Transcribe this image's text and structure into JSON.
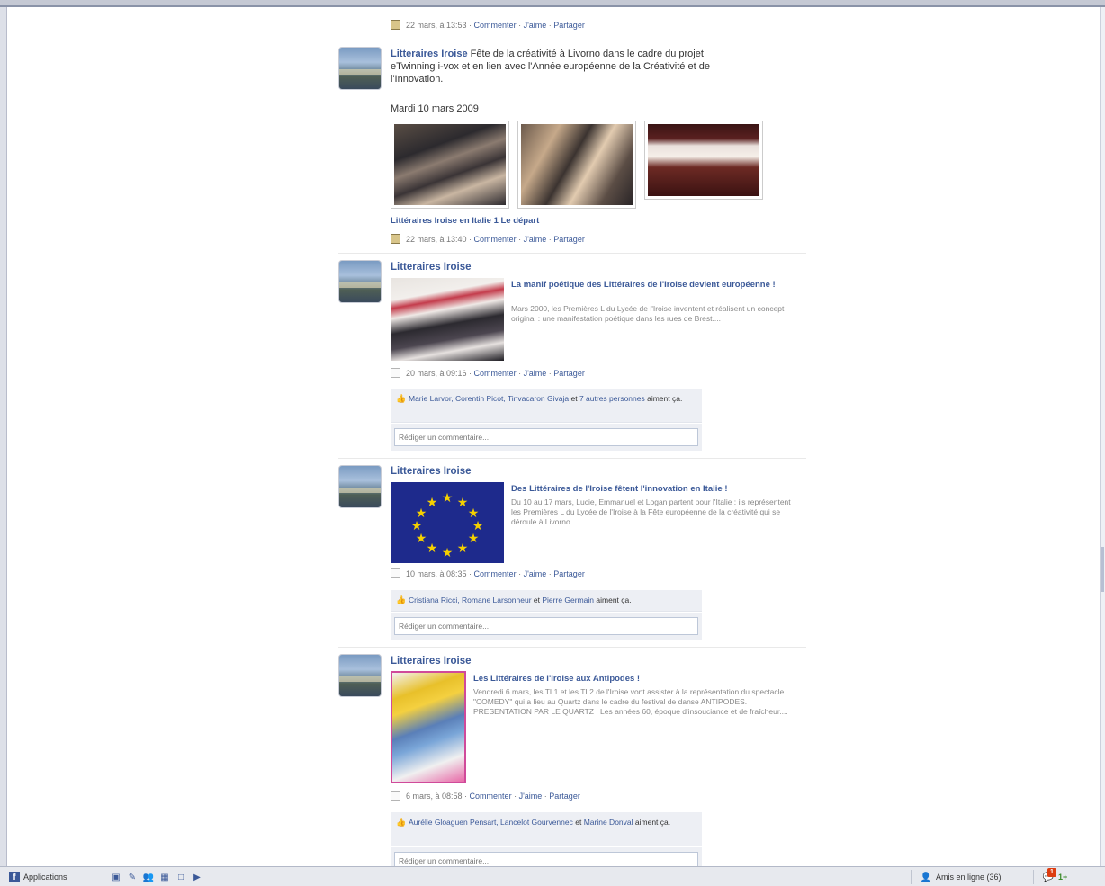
{
  "posts": [
    {
      "meta": {
        "time": "22 mars, à 13:53",
        "comment": "Commenter",
        "like": "J'aime",
        "share": "Partager"
      }
    },
    {
      "author": "Litteraires Iroise",
      "text": "Fête de la créativité à Livorno dans le cadre du projet eTwinning i-vox et en lien avec l'Année européenne de la Créativité et de l'Innovation.",
      "date_label": "Mardi 10 mars 2009",
      "album_title": "Littéraires Iroise en Italie 1 Le départ",
      "meta": {
        "time": "22 mars, à 13:40",
        "comment": "Commenter",
        "like": "J'aime",
        "share": "Partager"
      }
    },
    {
      "author": "Litteraires Iroise",
      "share_title": "La manif poétique des Littéraires de l'Iroise devient européenne !",
      "share_desc": "Mars 2000, les Premières L du Lycée de l'Iroise inventent et réalisent un concept original : une manifestation poétique dans les rues de Brest....",
      "meta": {
        "time": "20 mars, à 09:16",
        "comment": "Commenter",
        "like": "J'aime",
        "share": "Partager"
      },
      "likes_names": "Marie Larvor, Corentin Picot, Tinvacaron Givaja",
      "likes_and": "et",
      "likes_others": "7 autres personnes",
      "likes_suffix": "aiment ça.",
      "comment_placeholder": "Rédiger un commentaire..."
    },
    {
      "author": "Litteraires Iroise",
      "share_title": "Des Littéraires de l'Iroise fêtent l'innovation en Italie !",
      "share_desc": "Du 10 au 17 mars, Lucie, Emmanuel et Logan partent pour l'Italie : ils représentent les Premières L du Lycée de l'Iroise à la Fête européenne de la créativité qui se déroule à Livorno....",
      "meta": {
        "time": "10 mars, à 08:35",
        "comment": "Commenter",
        "like": "J'aime",
        "share": "Partager"
      },
      "likes_names": "Cristiana Ricci, Romane Larsonneur",
      "likes_and": "et",
      "likes_others": "Pierre Germain",
      "likes_suffix": "aiment ça.",
      "comment_placeholder": "Rédiger un commentaire..."
    },
    {
      "author": "Litteraires Iroise",
      "share_title": "Les Littéraires de l'Iroise aux Antipodes !",
      "share_desc": "Vendredi 6 mars, les TL1 et les TL2 de l'Iroise vont assister à la représentation du spectacle \"COMEDY\" qui a lieu au Quartz dans le cadre du festival de danse ANTIPODES. PRESENTATION PAR LE QUARTZ : Les années 60, époque d'insouciance et de fraîcheur....",
      "meta": {
        "time": "6 mars, à 08:58",
        "comment": "Commenter",
        "like": "J'aime",
        "share": "Partager"
      },
      "likes_names": "Aurélie Gloaguen Pensart, Lancelot Gourvennec",
      "likes_and": "et",
      "likes_others": "Marine Donval",
      "likes_suffix": "aiment ça.",
      "comment_placeholder": "Rédiger un commentaire..."
    }
  ],
  "bottombar": {
    "applications": "Applications",
    "online_friends": "Amis en ligne (36)",
    "notif_count": "1",
    "chat_label": "1+"
  },
  "colors": {
    "link": "#3b5998",
    "likes_bg": "#edeff4",
    "badge": "#dd3c10"
  }
}
